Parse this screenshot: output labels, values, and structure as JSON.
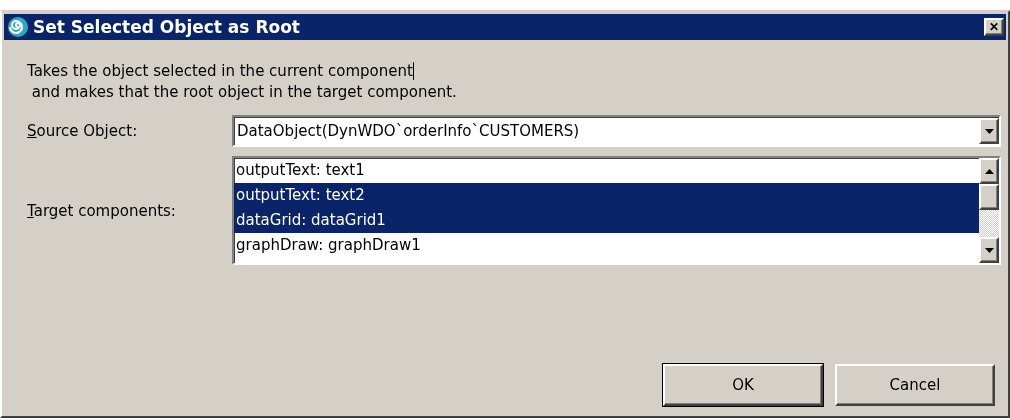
{
  "window": {
    "title": "Set Selected Object as Root",
    "close_label": "✕"
  },
  "description": [
    "Takes the object selected in the current component",
    " and makes that the root object in the target component."
  ],
  "source_object": {
    "label": "Source Object:",
    "value": "DataObject(DynWDO`orderInfo`CUSTOMERS)"
  },
  "target_components": {
    "label": "Target components:",
    "items": [
      {
        "label": "outputText: text1",
        "selected": false
      },
      {
        "label": "outputText: text2",
        "selected": true
      },
      {
        "label": "dataGrid: dataGrid1",
        "selected": true
      },
      {
        "label": "graphDraw: graphDraw1",
        "selected": false
      }
    ]
  },
  "buttons": [
    {
      "label": "OK",
      "default": true
    },
    {
      "label": "Cancel",
      "default": false
    }
  ]
}
